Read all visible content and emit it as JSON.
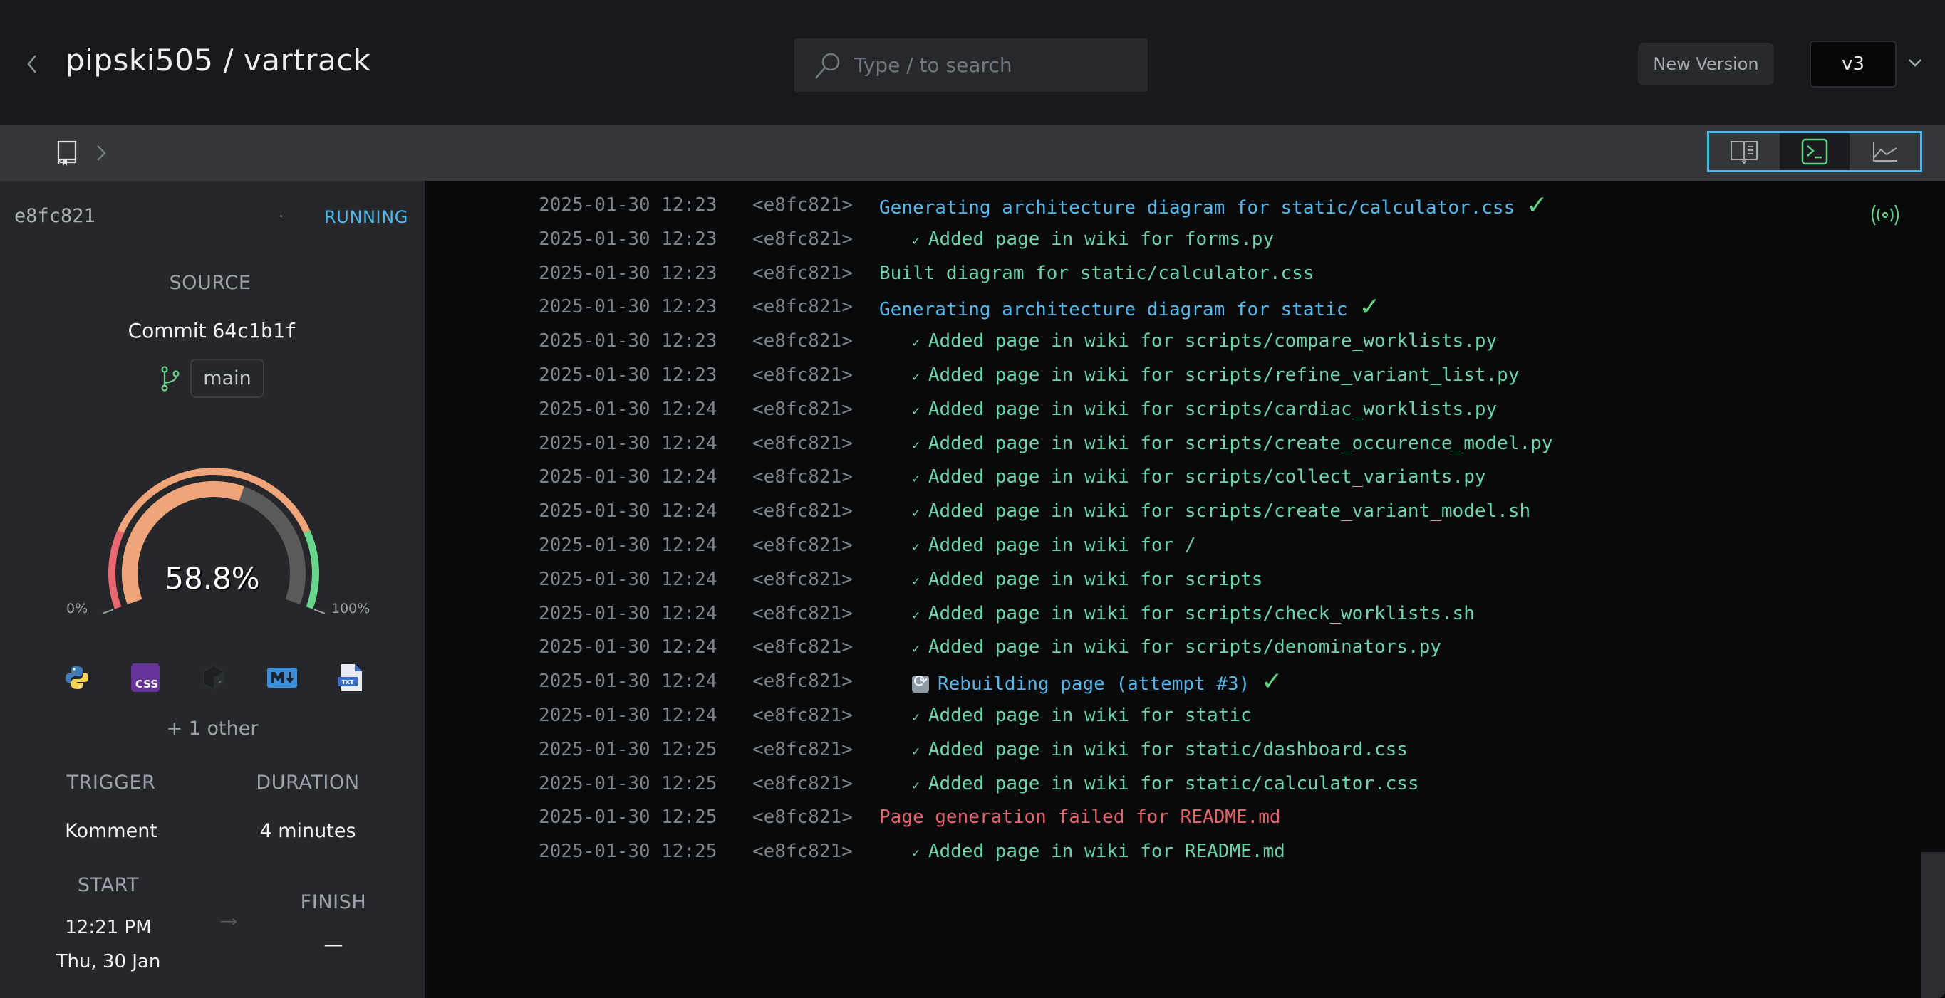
{
  "header": {
    "title": "pipski505 / vartrack",
    "search_placeholder": "Type / to search",
    "new_version_label": "New Version",
    "version_selected": "v3"
  },
  "toolbar": {
    "views": [
      {
        "name": "wiki",
        "icon": "book-open-icon",
        "active": false
      },
      {
        "name": "logs",
        "icon": "terminal-icon",
        "active": true
      },
      {
        "name": "metrics",
        "icon": "line-chart-icon",
        "active": false
      }
    ]
  },
  "sidebar": {
    "build_id": "e8fc821",
    "status": "RUNNING",
    "source_label": "SOURCE",
    "commit_prefix": "Commit",
    "commit_hash": "64c1b1f",
    "branch": "main",
    "progress_percent": 58.8,
    "progress_label": "58.8%",
    "gauge_min_label": "0%",
    "gauge_max_label": "100%",
    "languages": [
      {
        "name": "Python",
        "icon": "python-icon"
      },
      {
        "name": "CSS",
        "icon": "css-icon"
      },
      {
        "name": "Shell",
        "icon": "shell-icon"
      },
      {
        "name": "Markdown",
        "icon": "markdown-icon"
      },
      {
        "name": "Text",
        "icon": "txt-file-icon"
      }
    ],
    "others_label": "+ 1 other",
    "trigger_label": "TRIGGER",
    "trigger_value": "Komment",
    "duration_label": "DURATION",
    "duration_value": "4 minutes",
    "start_label": "START",
    "start_time": "12:21 PM",
    "start_date": "Thu, 30 Jan",
    "finish_label": "FINISH",
    "finish_value": "—"
  },
  "log": {
    "lines": [
      {
        "ts": "2025-01-30 12:23",
        "src": "<e8fc821>",
        "type": "info",
        "indent": false,
        "text": "Generating architecture diagram for static/calculator.css",
        "check": true
      },
      {
        "ts": "2025-01-30 12:23",
        "src": "<e8fc821>",
        "type": "success",
        "indent": true,
        "text": "Added page in wiki for forms.py",
        "check": false
      },
      {
        "ts": "2025-01-30 12:23",
        "src": "<e8fc821>",
        "type": "success",
        "indent": false,
        "text": "Built diagram for static/calculator.css",
        "check": false
      },
      {
        "ts": "2025-01-30 12:23",
        "src": "<e8fc821>",
        "type": "info",
        "indent": false,
        "text": "Generating architecture diagram for static",
        "check": true
      },
      {
        "ts": "2025-01-30 12:23",
        "src": "<e8fc821>",
        "type": "success",
        "indent": true,
        "text": "Added page in wiki for scripts/compare_worklists.py",
        "check": false
      },
      {
        "ts": "2025-01-30 12:23",
        "src": "<e8fc821>",
        "type": "success",
        "indent": true,
        "text": "Added page in wiki for scripts/refine_variant_list.py",
        "check": false
      },
      {
        "ts": "2025-01-30 12:24",
        "src": "<e8fc821>",
        "type": "success",
        "indent": true,
        "text": "Added page in wiki for scripts/cardiac_worklists.py",
        "check": false
      },
      {
        "ts": "2025-01-30 12:24",
        "src": "<e8fc821>",
        "type": "success",
        "indent": true,
        "text": "Added page in wiki for scripts/create_occurence_model.py",
        "check": false
      },
      {
        "ts": "2025-01-30 12:24",
        "src": "<e8fc821>",
        "type": "success",
        "indent": true,
        "text": "Added page in wiki for scripts/collect_variants.py",
        "check": false
      },
      {
        "ts": "2025-01-30 12:24",
        "src": "<e8fc821>",
        "type": "success",
        "indent": true,
        "text": "Added page in wiki for scripts/create_variant_model.sh",
        "check": false
      },
      {
        "ts": "2025-01-30 12:24",
        "src": "<e8fc821>",
        "type": "success",
        "indent": true,
        "text": "Added page in wiki for /",
        "check": false
      },
      {
        "ts": "2025-01-30 12:24",
        "src": "<e8fc821>",
        "type": "success",
        "indent": true,
        "text": "Added page in wiki for scripts",
        "check": false
      },
      {
        "ts": "2025-01-30 12:24",
        "src": "<e8fc821>",
        "type": "success",
        "indent": true,
        "text": "Added page in wiki for scripts/check_worklists.sh",
        "check": false
      },
      {
        "ts": "2025-01-30 12:24",
        "src": "<e8fc821>",
        "type": "success",
        "indent": true,
        "text": "Added page in wiki for scripts/denominators.py",
        "check": false
      },
      {
        "ts": "2025-01-30 12:24",
        "src": "<e8fc821>",
        "type": "rebuild",
        "indent": true,
        "text": "Rebuilding page (attempt #3)",
        "check": true
      },
      {
        "ts": "2025-01-30 12:24",
        "src": "<e8fc821>",
        "type": "success",
        "indent": true,
        "text": "Added page in wiki for static",
        "check": false
      },
      {
        "ts": "2025-01-30 12:25",
        "src": "<e8fc821>",
        "type": "success",
        "indent": true,
        "text": "Added page in wiki for static/dashboard.css",
        "check": false
      },
      {
        "ts": "2025-01-30 12:25",
        "src": "<e8fc821>",
        "type": "success",
        "indent": true,
        "text": "Added page in wiki for static/calculator.css",
        "check": false
      },
      {
        "ts": "2025-01-30 12:25",
        "src": "<e8fc821>",
        "type": "error",
        "indent": false,
        "text": "Page generation failed for README.md",
        "check": false
      },
      {
        "ts": "2025-01-30 12:25",
        "src": "<e8fc821>",
        "type": "success",
        "indent": true,
        "text": "Added page in wiki for README.md",
        "check": false
      }
    ]
  },
  "colors": {
    "accent_blue": "#4fb6e8",
    "success_green": "#6fd3a8",
    "check_green": "#64d185",
    "error_red": "#e5646b",
    "gauge_progress": "#f0a47a",
    "gauge_remaining": "#5a5a5a"
  }
}
